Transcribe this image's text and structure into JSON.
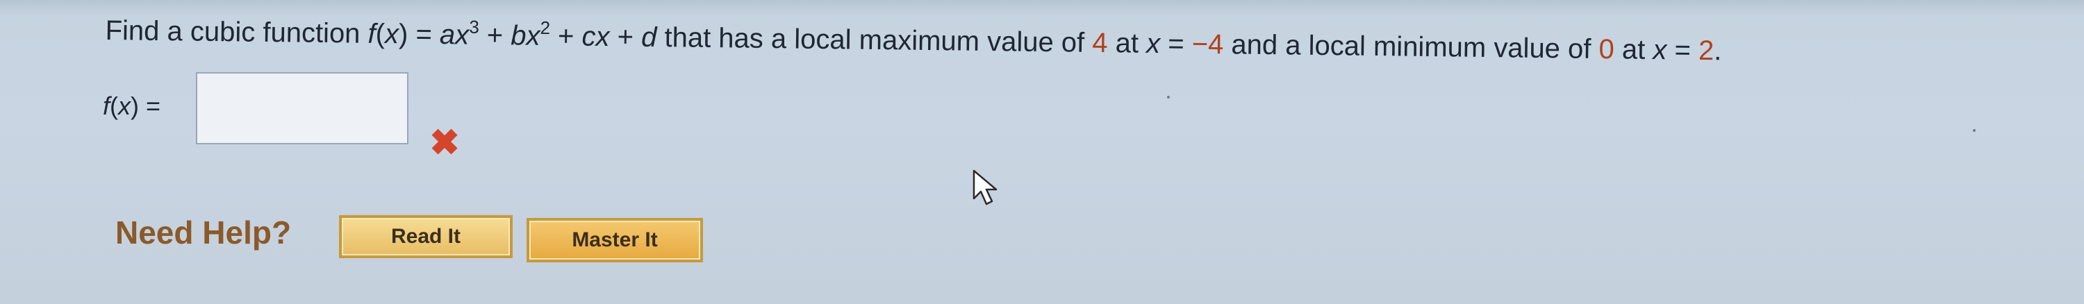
{
  "problem": {
    "prefix": "Find a cubic function ",
    "function_name": "f",
    "var_open": "(",
    "var": "x",
    "var_close": ")",
    "equals": " = ",
    "a": "a",
    "x1": "x",
    "exp3": "3",
    "plus1": " + ",
    "b": "b",
    "x2": "x",
    "exp2": "2",
    "plus2": " + ",
    "c": "c",
    "x3": "x",
    "plus3": " + ",
    "d": "d",
    "text_local_max": " that has a local maximum value of ",
    "max_value": "4",
    "at1": " at ",
    "x_at1": "x",
    "eq1": " = ",
    "max_x": "−4",
    "text_local_min": " and a local minimum value of ",
    "min_value": "0",
    "at2": " at ",
    "x_at2": "x",
    "eq2": " = ",
    "min_x": "2",
    "end": "."
  },
  "answer": {
    "label_f": "f",
    "label_paren": "(",
    "label_x": "x",
    "label_close": ")",
    "label_equals": " =",
    "value": "",
    "status_mark": "✖",
    "status_color": "#d4452c"
  },
  "help": {
    "label": "Need Help?",
    "read_it": "Read It",
    "master_it": "Master It"
  },
  "icons": {
    "status": "wrong-x-icon",
    "pointer": "mouse-cursor-icon"
  }
}
